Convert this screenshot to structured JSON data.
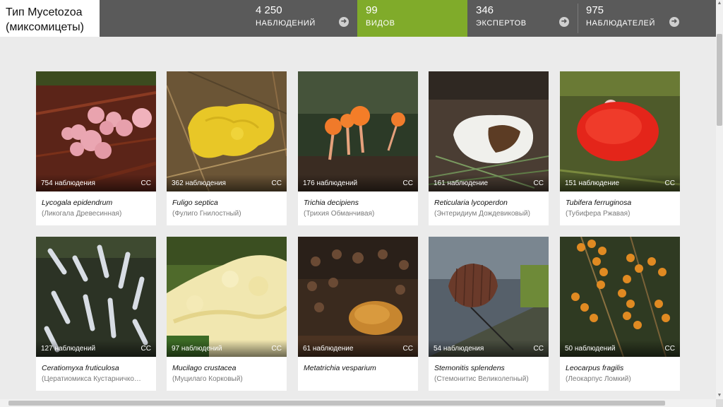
{
  "header": {
    "title_line1": "Тип Mycetozoa",
    "title_line2": "(миксомицеты)",
    "stats": [
      {
        "value": "4 250",
        "label": "НАБЛЮДЕНИЙ"
      },
      {
        "value": "99",
        "label": "ВИДОВ"
      },
      {
        "value": "346",
        "label": "ЭКСПЕРТОВ"
      },
      {
        "value": "975",
        "label": "НАБЛЮДАТЕЛЕЙ"
      }
    ],
    "accent_color": "#80ab2a",
    "bar_color": "#5a5a5a"
  },
  "cards": [
    {
      "count": "754 наблюдения",
      "cc": "CC",
      "latin": "Lycogala epidendrum",
      "ru": "(Ликогала Древесинная)"
    },
    {
      "count": "362 наблюдения",
      "cc": "CC",
      "latin": "Fuligo septica",
      "ru": "(Фулиго Гнилостный)"
    },
    {
      "count": "176 наблюдений",
      "cc": "CC",
      "latin": "Trichia decipiens",
      "ru": "(Трихия Обманчивая)"
    },
    {
      "count": "161 наблюдение",
      "cc": "CC",
      "latin": "Reticularia lycoperdon",
      "ru": "(Энтеридиум Дождевиковый)"
    },
    {
      "count": "151 наблюдение",
      "cc": "CC",
      "latin": "Tubifera ferruginosa",
      "ru": "(Тубифера Ржавая)"
    },
    {
      "count": "127 наблюдений",
      "cc": "CC",
      "latin": "Ceratiomyxa fruticulosa",
      "ru": "(Цератиомикса Кустарничко…"
    },
    {
      "count": "97 наблюдений",
      "cc": "CC",
      "latin": "Mucilago crustacea",
      "ru": "(Муцилаго Корковый)"
    },
    {
      "count": "61 наблюдение",
      "cc": "CC",
      "latin": "Metatrichia vesparium",
      "ru": ""
    },
    {
      "count": "54 наблюдения",
      "cc": "CC",
      "latin": "Stemonitis splendens",
      "ru": "(Стемонитис Великолепный)"
    },
    {
      "count": "50 наблюдений",
      "cc": "CC",
      "latin": "Leocarpus fragilis",
      "ru": "(Леокарпус Ломкий)"
    }
  ]
}
